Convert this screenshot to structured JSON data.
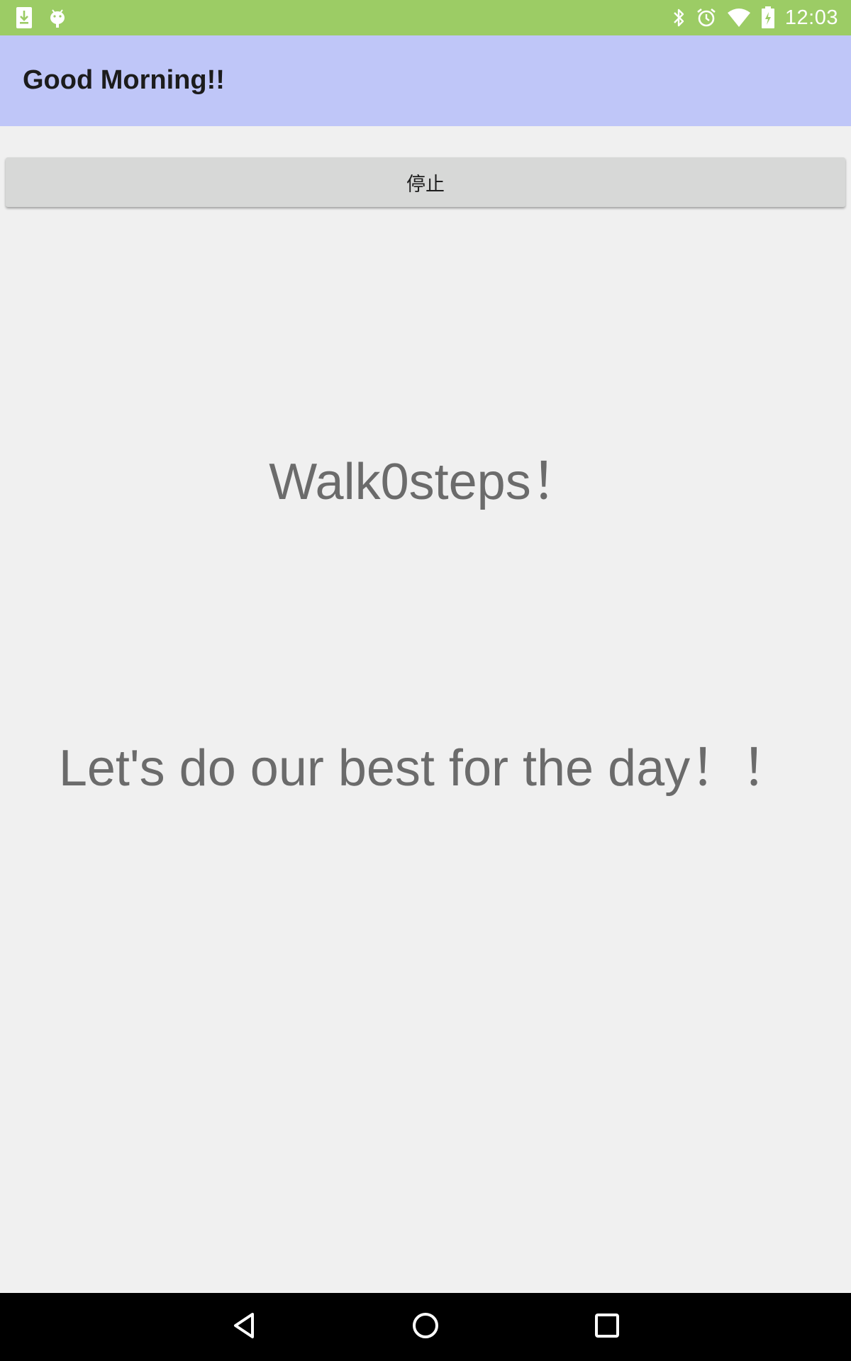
{
  "status_bar": {
    "time": "12:03",
    "background_color": "#9ccc65",
    "left_icons": [
      "download-icon",
      "android-debug-icon"
    ],
    "right_icons": [
      "bluetooth-icon",
      "alarm-icon",
      "wifi-icon",
      "battery-charging-icon"
    ]
  },
  "app_bar": {
    "title": "Good Morning!!",
    "background_color": "#bfc6f8"
  },
  "controls": {
    "stop_label": "停止"
  },
  "main": {
    "steps_text": "Walk0steps！",
    "motto_text": "Let's do our best for the day！！"
  },
  "nav_bar": {
    "buttons": [
      "back-icon",
      "home-icon",
      "recents-icon"
    ]
  }
}
